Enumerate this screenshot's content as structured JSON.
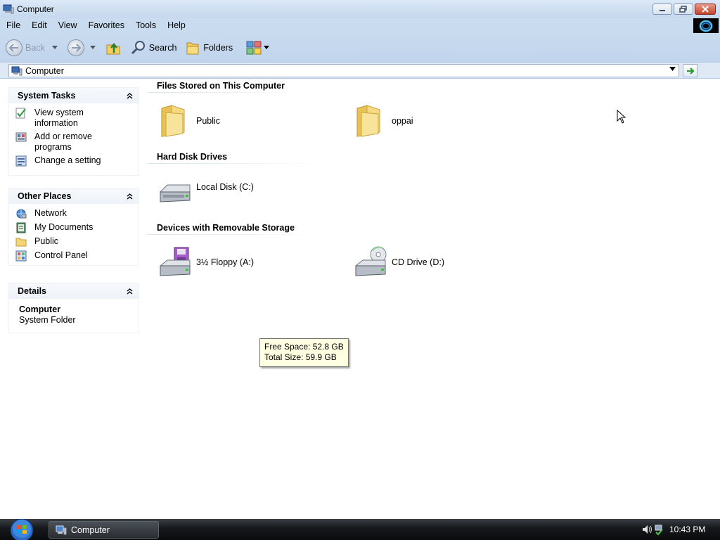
{
  "window": {
    "title": "Computer"
  },
  "menu": [
    "File",
    "Edit",
    "View",
    "Favorites",
    "Tools",
    "Help"
  ],
  "toolbar": {
    "back": "Back",
    "search": "Search",
    "folders": "Folders"
  },
  "address": {
    "value": "Computer"
  },
  "panels": {
    "system_tasks": {
      "title": "System Tasks",
      "items": [
        {
          "label1": "View system",
          "label2": "information",
          "icon": "check-icon"
        },
        {
          "label1": "Add or remove",
          "label2": "programs",
          "icon": "programs-icon"
        },
        {
          "label1": "Change a setting",
          "label2": "",
          "icon": "setting-icon"
        }
      ]
    },
    "other_places": {
      "title": "Other Places",
      "items": [
        {
          "label": "Network",
          "icon": "network-icon"
        },
        {
          "label": "My Documents",
          "icon": "my-documents-icon"
        },
        {
          "label": "Public",
          "icon": "folder-icon"
        },
        {
          "label": "Control Panel",
          "icon": "control-panel-icon"
        }
      ]
    },
    "details": {
      "title": "Details",
      "name": "Computer",
      "type": "System Folder"
    }
  },
  "groups": {
    "files": {
      "title": "Files Stored on This Computer",
      "items": [
        "Public",
        "oppai"
      ]
    },
    "hard_disks": {
      "title": "Hard Disk Drives",
      "items": [
        "Local Disk (C:)"
      ]
    },
    "removable": {
      "title": "Devices with Removable Storage",
      "items": [
        "3½ Floppy (A:)",
        "CD Drive (D:)"
      ]
    }
  },
  "tooltip": {
    "line1": "Free Space: 52.8 GB",
    "line2": "Total Size: 59.9 GB"
  },
  "taskbar": {
    "window_label": "Computer",
    "clock": "10:43 PM"
  },
  "colors": {
    "titlebar": "#c9dbef",
    "close": "#c3412a",
    "taskbar": "#16181b",
    "tooltip": "#ffffe1"
  }
}
